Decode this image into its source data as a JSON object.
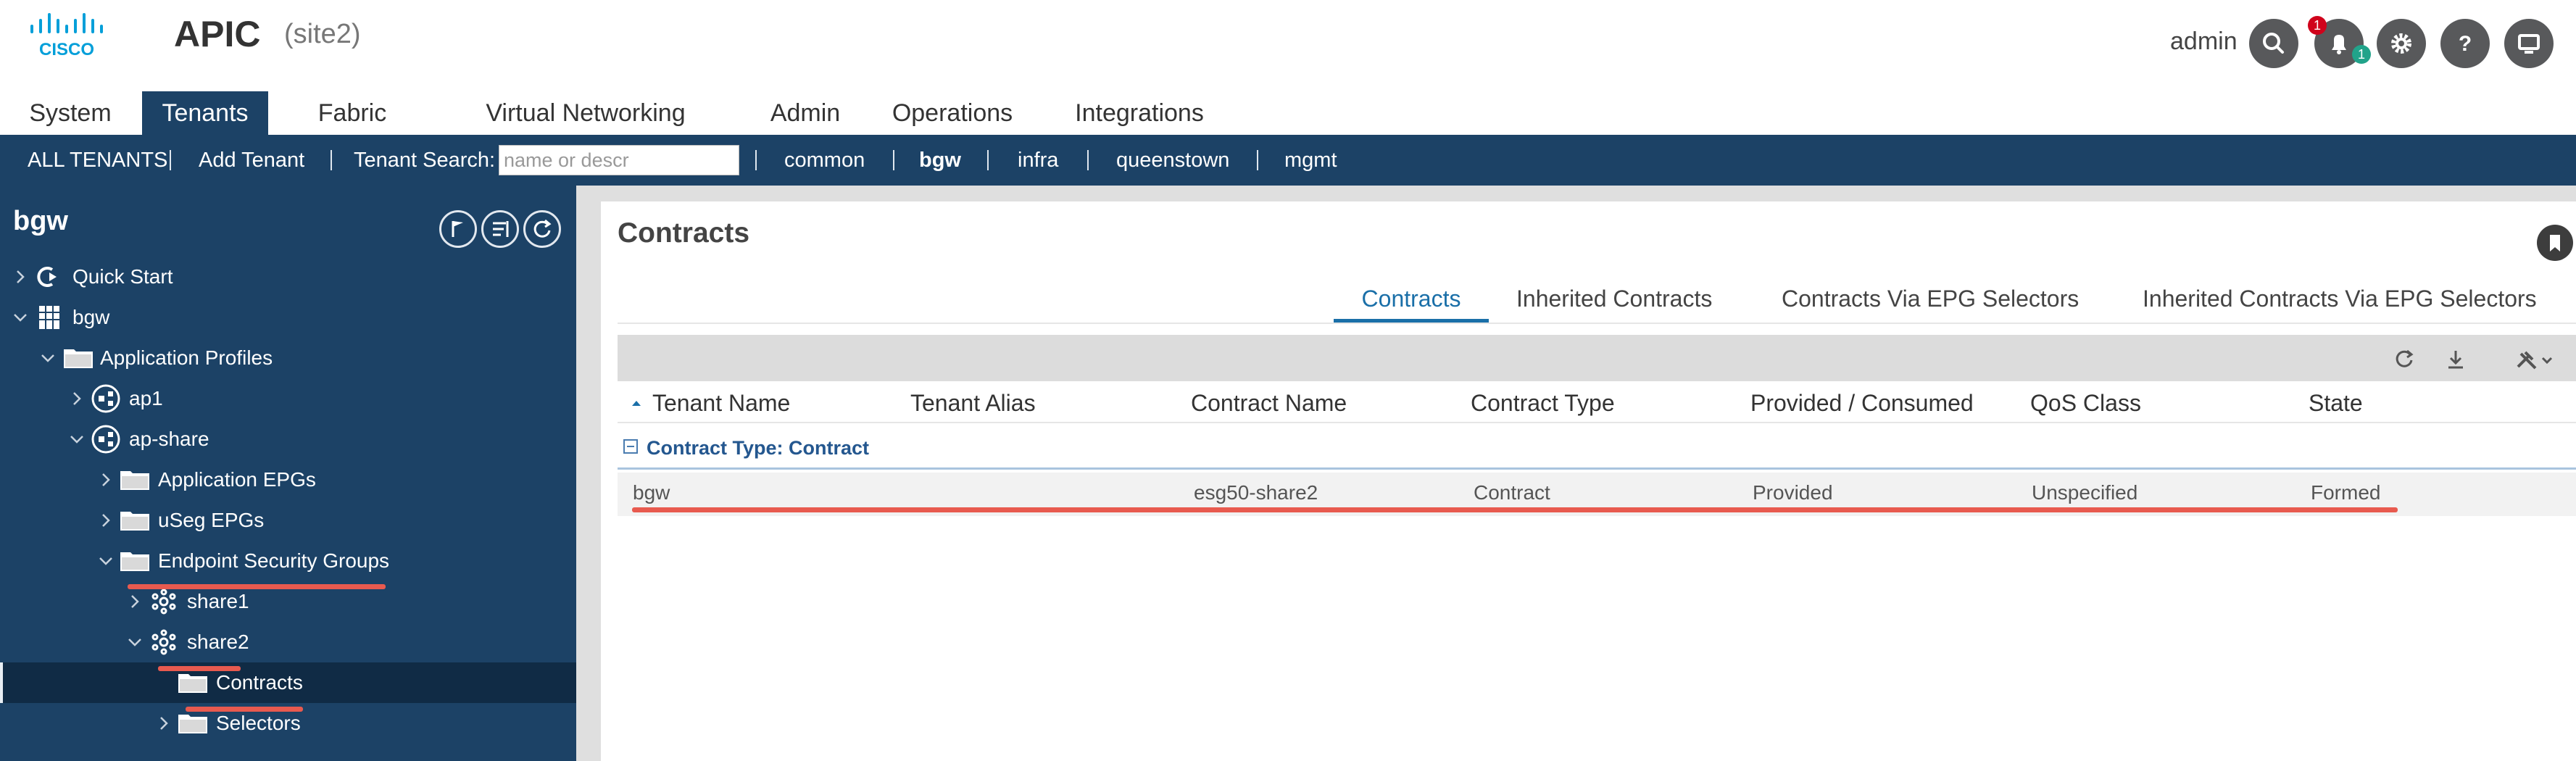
{
  "header": {
    "app_name": "APIC",
    "site": "(site2)",
    "user": "admin",
    "notifications_red_badge": "1",
    "notifications_teal_badge": "1",
    "brand_color": "#1c4266",
    "icons": [
      "search-icon",
      "bell-icon",
      "gear-icon",
      "help-icon",
      "screen-icon"
    ]
  },
  "nav": {
    "tabs": [
      "System",
      "Tenants",
      "Fabric",
      "Virtual Networking",
      "Admin",
      "Operations",
      "Integrations"
    ],
    "active": "Tenants"
  },
  "subbar": {
    "all_tenants": "ALL TENANTS",
    "add_tenant": "Add Tenant",
    "search_label": "Tenant Search:",
    "search_placeholder": "name or descr",
    "tenants": [
      "common",
      "bgw",
      "infra",
      "queenstown",
      "mgmt"
    ],
    "active_tenant": "bgw"
  },
  "sidebar": {
    "title": "bgw",
    "tree": [
      {
        "label": "Quick Start",
        "icon": "quickstart-icon"
      },
      {
        "label": "bgw",
        "icon": "tenant-grid-icon"
      },
      {
        "label": "Application Profiles",
        "icon": "folder-icon"
      },
      {
        "label": "ap1",
        "icon": "app-profile-icon"
      },
      {
        "label": "ap-share",
        "icon": "app-profile-icon"
      },
      {
        "label": "Application EPGs",
        "icon": "folder-icon"
      },
      {
        "label": "uSeg EPGs",
        "icon": "folder-icon"
      },
      {
        "label": "Endpoint Security Groups",
        "icon": "folder-icon"
      },
      {
        "label": "share1",
        "icon": "esg-icon"
      },
      {
        "label": "share2",
        "icon": "esg-icon"
      },
      {
        "label": "Contracts",
        "icon": "folder-icon"
      },
      {
        "label": "Selectors",
        "icon": "folder-icon"
      }
    ],
    "selected": "Contracts"
  },
  "main": {
    "title": "Contracts",
    "tabs": [
      "Contracts",
      "Inherited Contracts",
      "Contracts Via EPG Selectors",
      "Inherited Contracts Via EPG Selectors"
    ],
    "active_tab": "Contracts",
    "columns": [
      "Tenant Name",
      "Tenant Alias",
      "Contract Name",
      "Contract Type",
      "Provided / Consumed",
      "QoS Class",
      "State"
    ],
    "group_label": "Contract Type: Contract",
    "rows": [
      [
        "bgw",
        "",
        "esg50-share2",
        "Contract",
        "Provided",
        "Unspecified",
        "Formed"
      ]
    ],
    "highlight_color": "#e85a4f",
    "accent_color": "#1a6fa8"
  }
}
